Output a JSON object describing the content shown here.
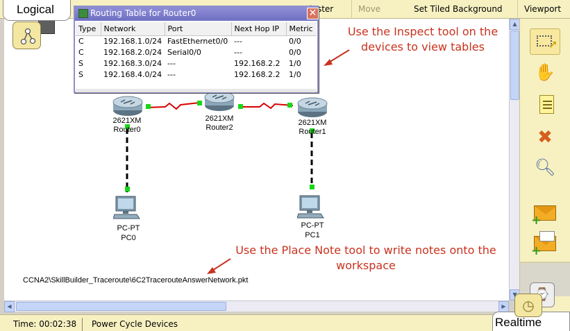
{
  "tabs": {
    "logical": "Logical",
    "realtime": "Realtime"
  },
  "top_menu": {
    "cluster": "luster",
    "move_object": "Move Object",
    "set_tiled_background": "Set Tiled Background",
    "viewport": "Viewport"
  },
  "routing_window": {
    "title": "Routing Table for Router0",
    "columns": [
      "Type",
      "Network",
      "Port",
      "Next Hop IP",
      "Metric"
    ],
    "rows": [
      [
        "C",
        "192.168.1.0/24",
        "FastEthernet0/0",
        "---",
        "0/0"
      ],
      [
        "C",
        "192.168.2.0/24",
        "Serial0/0",
        "---",
        "0/0"
      ],
      [
        "S",
        "192.168.3.0/24",
        "---",
        "192.168.2.2",
        "1/0"
      ],
      [
        "S",
        "192.168.4.0/24",
        "---",
        "192.168.2.2",
        "1/0"
      ]
    ]
  },
  "notes": {
    "inspect": "Use the Inspect tool on the devices to view tables",
    "place_note": "Use the Place Note tool to write notes onto the workspace"
  },
  "file_path": "CCNA2\\SkillBuilder_Traceroute\\6C2TracerouteAnswerNetwork.pkt",
  "devices": {
    "router0": {
      "model": "2621XM",
      "name": "Router0"
    },
    "router1": {
      "model": "2621XM",
      "name": "Router1"
    },
    "router2": {
      "model": "2621XM",
      "name": "Router2"
    },
    "pc0": {
      "model": "PC-PT",
      "name": "PC0"
    },
    "pc1": {
      "model": "PC-PT",
      "name": "PC1"
    }
  },
  "status": {
    "time": "Time: 00:02:38",
    "power_cycle": "Power Cycle Devices"
  },
  "colors": {
    "serial_link": "#d80000",
    "link_light": "#19d619",
    "note_text": "#c8321e",
    "toolbar_bg": "#f7f1c2",
    "window_title": "#7f7fce"
  }
}
